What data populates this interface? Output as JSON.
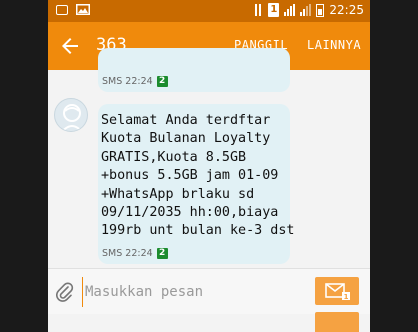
{
  "status_bar": {
    "time": "22:25",
    "sim": "1",
    "signal_label": "R"
  },
  "action_bar": {
    "title": "363",
    "call_label": "PANGGIL",
    "more_label": "LAINNYA"
  },
  "messages": [
    {
      "text": "",
      "time": "SMS 22:24",
      "sim": "2"
    },
    {
      "text": "Selamat Anda terdftar\nKuota Bulanan Loyalty\nGRATIS,Kuota 8.5GB\n+bonus 5.5GB jam 01-09\n+WhatsApp brlaku sd\n09/11/2035 hh:00,biaya\n199rb unt bulan ke-3 dst",
      "time": "SMS 22:24",
      "sim": "2"
    }
  ],
  "compose": {
    "placeholder": "Masukkan pesan"
  },
  "colors": {
    "action_bar": "#f08a0c",
    "status_bar": "#c86a00",
    "bubble": "#e1f1f5",
    "sim_tag": "#1c8c2e"
  }
}
